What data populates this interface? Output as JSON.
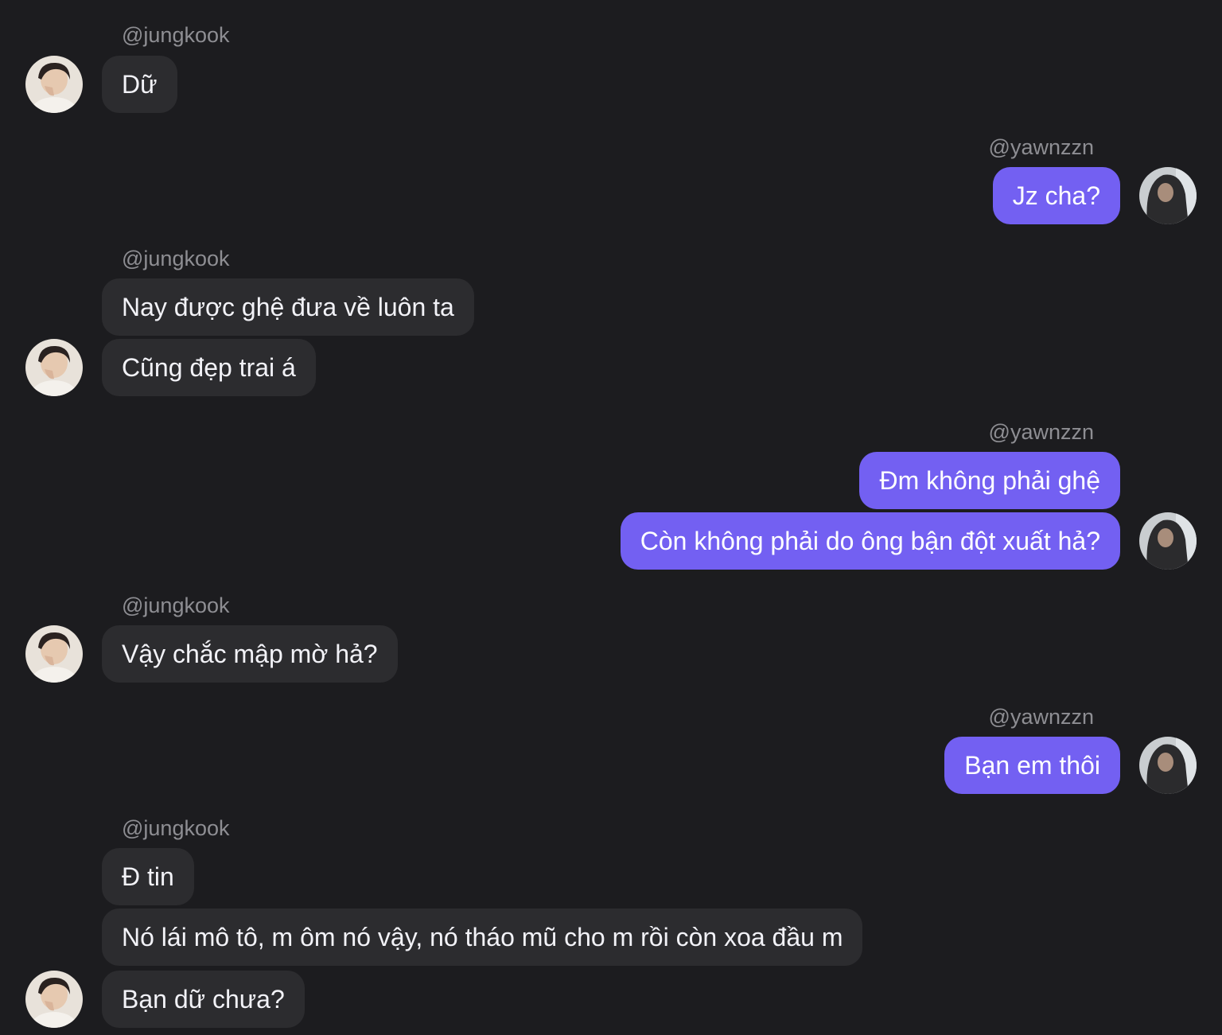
{
  "messages": [
    {
      "sender": "@jungkook",
      "text": "Dữ"
    },
    {
      "sender": "@yawnzzn",
      "text": "Jz cha?"
    },
    {
      "sender": "@jungkook",
      "text": "Nay được ghệ đưa về luôn ta"
    },
    {
      "sender": "@jungkook",
      "text": "Cũng đẹp trai á"
    },
    {
      "sender": "@yawnzzn",
      "text": "Đm không phải ghệ"
    },
    {
      "sender": "@yawnzzn",
      "text": "Còn không phải do ông bận đột xuất hả?"
    },
    {
      "sender": "@jungkook",
      "text": "Vậy chắc mập mờ hả?"
    },
    {
      "sender": "@yawnzzn",
      "text": "Bạn em thôi"
    },
    {
      "sender": "@jungkook",
      "text": "Đ tin"
    },
    {
      "sender": "@jungkook",
      "text": "Nó lái mô tô, m ôm nó vậy, nó tháo mũ cho m rồi còn xoa đầu m"
    },
    {
      "sender": "@jungkook",
      "text": "Bạn dữ chưa?"
    }
  ],
  "colors": {
    "background": "#1c1c1f",
    "incoming_bubble": "#2c2c2f",
    "outgoing_bubble": "#7360f2",
    "username": "#8e8e93"
  },
  "icons": {
    "jungkook_avatar": "user-avatar-photo",
    "yawnzzn_avatar": "user-avatar-photo"
  }
}
